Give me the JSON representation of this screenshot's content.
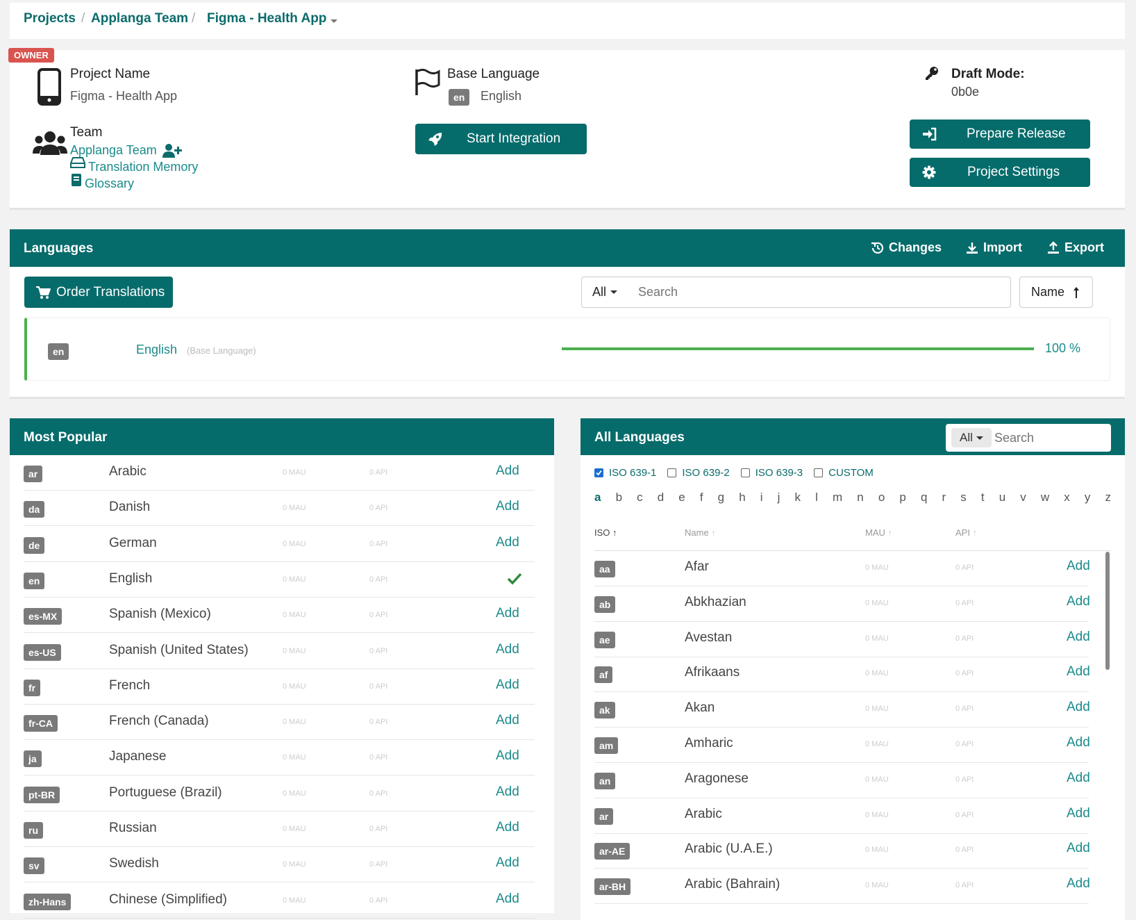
{
  "breadcrumb": {
    "projects": "Projects",
    "team": "Applanga Team",
    "app": "Figma - Health App",
    "sep1": "/",
    "sep2": "/"
  },
  "owner_badge": "OWNER",
  "project": {
    "name_label": "Project Name",
    "name_value": "Figma - Health App",
    "team_label": "Team",
    "team_link": "Applanga Team",
    "tm_link": "Translation Memory",
    "glossary_link": "Glossary"
  },
  "base": {
    "label": "Base Language",
    "code": "en",
    "name": "English",
    "start_btn": "Start Integration"
  },
  "draft": {
    "label": "Draft Mode:",
    "value": "0b0e",
    "prepare_btn": "Prepare Release",
    "settings_btn": "Project Settings"
  },
  "languages": {
    "title": "Languages",
    "changes": "Changes",
    "import": "Import",
    "export": "Export",
    "order_btn": "Order Translations",
    "filter": "All",
    "search_placeholder": "Search",
    "sort": "Name",
    "base_row": {
      "code": "en",
      "name": "English",
      "note": "(Base Language)",
      "progress": 100,
      "percent": "100 %"
    }
  },
  "popular": {
    "title": "Most Popular",
    "rows": [
      {
        "code": "ar",
        "name": "Arabic",
        "mau": "0 MAU",
        "api": "0 API",
        "action": "Add"
      },
      {
        "code": "da",
        "name": "Danish",
        "mau": "0 MAU",
        "api": "0 API",
        "action": "Add"
      },
      {
        "code": "de",
        "name": "German",
        "mau": "0 MAU",
        "api": "0 API",
        "action": "Add"
      },
      {
        "code": "en",
        "name": "English",
        "mau": "0 MAU",
        "api": "0 API",
        "action": "check"
      },
      {
        "code": "es-MX",
        "name": "Spanish (Mexico)",
        "mau": "0 MAU",
        "api": "0 API",
        "action": "Add"
      },
      {
        "code": "es-US",
        "name": "Spanish (United States)",
        "mau": "0 MAU",
        "api": "0 API",
        "action": "Add"
      },
      {
        "code": "fr",
        "name": "French",
        "mau": "0 MAU",
        "api": "0 API",
        "action": "Add"
      },
      {
        "code": "fr-CA",
        "name": "French (Canada)",
        "mau": "0 MAU",
        "api": "0 API",
        "action": "Add"
      },
      {
        "code": "ja",
        "name": "Japanese",
        "mau": "0 MAU",
        "api": "0 API",
        "action": "Add"
      },
      {
        "code": "pt-BR",
        "name": "Portuguese (Brazil)",
        "mau": "0 MAU",
        "api": "0 API",
        "action": "Add"
      },
      {
        "code": "ru",
        "name": "Russian",
        "mau": "0 MAU",
        "api": "0 API",
        "action": "Add"
      },
      {
        "code": "sv",
        "name": "Swedish",
        "mau": "0 MAU",
        "api": "0 API",
        "action": "Add"
      },
      {
        "code": "zh-Hans",
        "name": "Chinese (Simplified)",
        "mau": "0 MAU",
        "api": "0 API",
        "action": "Add"
      }
    ]
  },
  "all": {
    "title": "All Languages",
    "filter": "All",
    "search_placeholder": "Search",
    "checks": [
      {
        "label": "ISO 639-1",
        "checked": true
      },
      {
        "label": "ISO 639-2",
        "checked": false
      },
      {
        "label": "ISO 639-3",
        "checked": false
      },
      {
        "label": "CUSTOM",
        "checked": false
      }
    ],
    "letters": [
      "a",
      "b",
      "c",
      "d",
      "e",
      "f",
      "g",
      "h",
      "i",
      "j",
      "k",
      "l",
      "m",
      "n",
      "o",
      "p",
      "q",
      "r",
      "s",
      "t",
      "u",
      "v",
      "w",
      "x",
      "y",
      "z"
    ],
    "cols": {
      "iso": "ISO",
      "name": "Name",
      "mau": "MAU",
      "api": "API"
    },
    "rows": [
      {
        "code": "aa",
        "name": "Afar",
        "mau": "0 MAU",
        "api": "0 API",
        "action": "Add"
      },
      {
        "code": "ab",
        "name": "Abkhazian",
        "mau": "0 MAU",
        "api": "0 API",
        "action": "Add"
      },
      {
        "code": "ae",
        "name": "Avestan",
        "mau": "0 MAU",
        "api": "0 API",
        "action": "Add"
      },
      {
        "code": "af",
        "name": "Afrikaans",
        "mau": "0 MAU",
        "api": "0 API",
        "action": "Add"
      },
      {
        "code": "ak",
        "name": "Akan",
        "mau": "0 MAU",
        "api": "0 API",
        "action": "Add"
      },
      {
        "code": "am",
        "name": "Amharic",
        "mau": "0 MAU",
        "api": "0 API",
        "action": "Add"
      },
      {
        "code": "an",
        "name": "Aragonese",
        "mau": "0 MAU",
        "api": "0 API",
        "action": "Add"
      },
      {
        "code": "ar",
        "name": "Arabic",
        "mau": "0 MAU",
        "api": "0 API",
        "action": "Add"
      },
      {
        "code": "ar-AE",
        "name": "Arabic (U.A.E.)",
        "mau": "0 MAU",
        "api": "0 API",
        "action": "Add"
      },
      {
        "code": "ar-BH",
        "name": "Arabic (Bahrain)",
        "mau": "0 MAU",
        "api": "0 API",
        "action": "Add"
      }
    ]
  }
}
